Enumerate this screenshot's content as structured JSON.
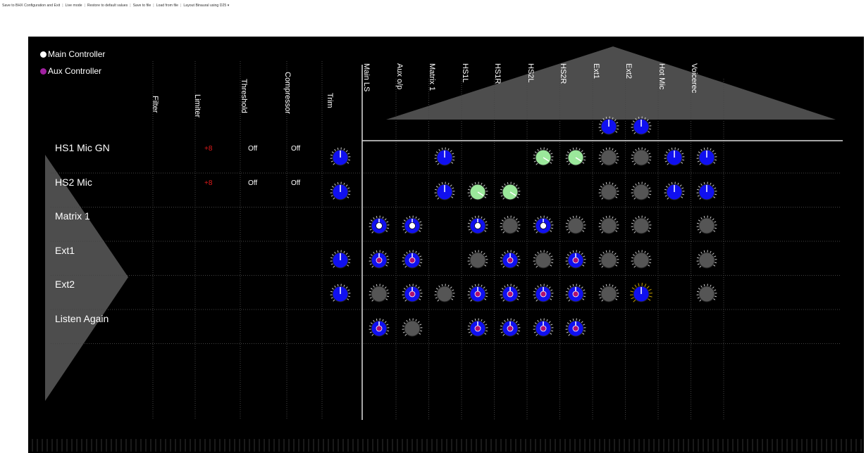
{
  "toolbar": {
    "items": [
      "Save to BHX Configuration and Exit",
      "Live mode",
      "Restore to default values",
      "Save to file",
      "Load from file",
      "Layout Binaural using D25 ▾"
    ]
  },
  "legend": {
    "main": "Main Controller",
    "aux": "Aux Controller"
  },
  "colors": {
    "main_dot": "#ffffff",
    "aux_dot": "#a020a0",
    "knob_blue": "#1010f0",
    "knob_green": "#9be89b",
    "knob_grey": "#555555",
    "value_red": "#e21b1b"
  },
  "processing_columns": [
    "Filter",
    "Limiter",
    "Threshold",
    "Compressor",
    "Trim"
  ],
  "output_columns": [
    "Main LS",
    "Aux o/p",
    "Matrix 1",
    "HS1L",
    "HS1R",
    "HS2L",
    "HS2R",
    "Ext1",
    "Ext2",
    "Hot Mic",
    "Voicerec"
  ],
  "rows": [
    {
      "label": "HS1 Mic GN",
      "limiter": "+8",
      "threshold": "Off",
      "compressor": "Off"
    },
    {
      "label": "HS2 Mic",
      "limiter": "+8",
      "threshold": "Off",
      "compressor": "Off"
    },
    {
      "label": "Matrix 1",
      "limiter": "",
      "threshold": "",
      "compressor": ""
    },
    {
      "label": "Ext1",
      "limiter": "",
      "threshold": "",
      "compressor": ""
    },
    {
      "label": "Ext2",
      "limiter": "",
      "threshold": "",
      "compressor": ""
    },
    {
      "label": "Listen Again",
      "limiter": "",
      "threshold": "",
      "compressor": ""
    }
  ],
  "top_knobs": [
    {
      "col": "Ext1",
      "type": "blue"
    },
    {
      "col": "Ext2",
      "type": "blue"
    }
  ],
  "knobs": [
    {
      "row": 0,
      "col": "Trim",
      "type": "blue"
    },
    {
      "row": 0,
      "col": "Matrix 1",
      "type": "blue"
    },
    {
      "row": 0,
      "col": "HS2L",
      "type": "green"
    },
    {
      "row": 0,
      "col": "HS2R",
      "type": "green"
    },
    {
      "row": 0,
      "col": "Ext1",
      "type": "grey"
    },
    {
      "row": 0,
      "col": "Ext2",
      "type": "grey"
    },
    {
      "row": 0,
      "col": "Hot Mic",
      "type": "blue"
    },
    {
      "row": 0,
      "col": "Voicerec",
      "type": "blue"
    },
    {
      "row": 1,
      "col": "Trim",
      "type": "blue"
    },
    {
      "row": 1,
      "col": "Matrix 1",
      "type": "blue"
    },
    {
      "row": 1,
      "col": "HS1L",
      "type": "green"
    },
    {
      "row": 1,
      "col": "HS1R",
      "type": "green"
    },
    {
      "row": 1,
      "col": "Ext1",
      "type": "grey"
    },
    {
      "row": 1,
      "col": "Ext2",
      "type": "grey"
    },
    {
      "row": 1,
      "col": "Hot Mic",
      "type": "blue"
    },
    {
      "row": 1,
      "col": "Voicerec",
      "type": "blue"
    },
    {
      "row": 2,
      "col": "Main LS",
      "type": "blue",
      "dot": "white"
    },
    {
      "row": 2,
      "col": "Aux o/p",
      "type": "blue",
      "dot": "white"
    },
    {
      "row": 2,
      "col": "HS1L",
      "type": "blue",
      "dot": "white"
    },
    {
      "row": 2,
      "col": "HS1R",
      "type": "grey"
    },
    {
      "row": 2,
      "col": "HS2L",
      "type": "blue",
      "dot": "white"
    },
    {
      "row": 2,
      "col": "HS2R",
      "type": "grey"
    },
    {
      "row": 2,
      "col": "Ext1",
      "type": "grey"
    },
    {
      "row": 2,
      "col": "Ext2",
      "type": "grey"
    },
    {
      "row": 2,
      "col": "Voicerec",
      "type": "grey"
    },
    {
      "row": 3,
      "col": "Trim",
      "type": "blue"
    },
    {
      "row": 3,
      "col": "Main LS",
      "type": "blue",
      "dot": "purple"
    },
    {
      "row": 3,
      "col": "Aux o/p",
      "type": "blue",
      "dot": "purple"
    },
    {
      "row": 3,
      "col": "HS1L",
      "type": "grey"
    },
    {
      "row": 3,
      "col": "HS1R",
      "type": "blue",
      "dot": "purple"
    },
    {
      "row": 3,
      "col": "HS2L",
      "type": "grey"
    },
    {
      "row": 3,
      "col": "HS2R",
      "type": "blue",
      "dot": "purple"
    },
    {
      "row": 3,
      "col": "Ext1",
      "type": "grey"
    },
    {
      "row": 3,
      "col": "Ext2",
      "type": "grey"
    },
    {
      "row": 3,
      "col": "Voicerec",
      "type": "grey"
    },
    {
      "row": 4,
      "col": "Trim",
      "type": "blue"
    },
    {
      "row": 4,
      "col": "Main LS",
      "type": "grey"
    },
    {
      "row": 4,
      "col": "Aux o/p",
      "type": "blue",
      "dot": "purple"
    },
    {
      "row": 4,
      "col": "Matrix 1",
      "type": "grey"
    },
    {
      "row": 4,
      "col": "HS1L",
      "type": "blue",
      "dot": "purple"
    },
    {
      "row": 4,
      "col": "HS1R",
      "type": "blue",
      "dot": "purple"
    },
    {
      "row": 4,
      "col": "HS2L",
      "type": "blue",
      "dot": "purple"
    },
    {
      "row": 4,
      "col": "HS2R",
      "type": "blue",
      "dot": "purple"
    },
    {
      "row": 4,
      "col": "Ext1",
      "type": "grey"
    },
    {
      "row": 4,
      "col": "Ext2",
      "type": "blue-large"
    },
    {
      "row": 4,
      "col": "Voicerec",
      "type": "grey"
    },
    {
      "row": 5,
      "col": "Main LS",
      "type": "blue",
      "dot": "purple"
    },
    {
      "row": 5,
      "col": "Aux o/p",
      "type": "grey"
    },
    {
      "row": 5,
      "col": "HS1L",
      "type": "blue",
      "dot": "purple"
    },
    {
      "row": 5,
      "col": "HS1R",
      "type": "blue",
      "dot": "purple"
    },
    {
      "row": 5,
      "col": "HS2L",
      "type": "blue",
      "dot": "purple"
    },
    {
      "row": 5,
      "col": "HS2R",
      "type": "blue",
      "dot": "purple"
    }
  ]
}
